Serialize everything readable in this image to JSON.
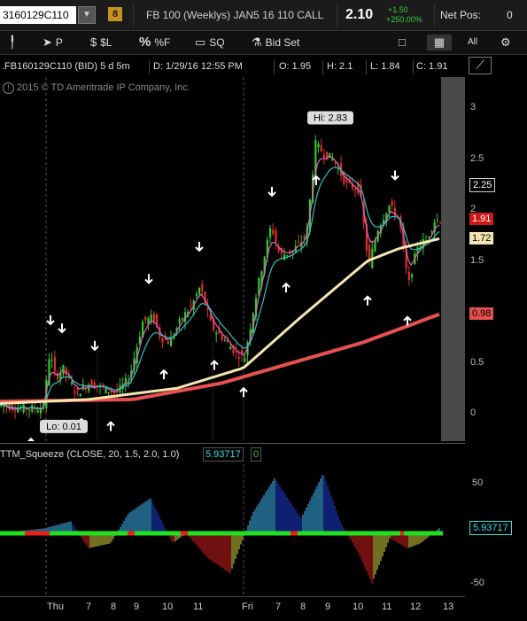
{
  "header": {
    "symbol": "3160129C110",
    "link_number": "8",
    "description": "FB 100 (Weeklys) JAN5 16 110 CALL",
    "last": "2.10",
    "change": "+1.50",
    "change_pct": "+250.00%",
    "net_pos_label": "Net Pos:",
    "net_pos_value": "0"
  },
  "toolbar": {
    "cursor_label": "P",
    "price_label": "$L",
    "percent_label": "%F",
    "sq_label": "SQ",
    "bidset_label": "Bid Set",
    "all_label": "All"
  },
  "chart_info": {
    "symbol": ".FB160129C110 (BID) 5 d 5m",
    "date": "D: 1/29/16 12:55 PM",
    "open": "O: 1.95",
    "high": "H: 2.1",
    "low": "L: 1.84",
    "close": "C: 1.91",
    "copyright": "2015 © TD Ameritrade IP Company, Inc.",
    "hi_label": "Hi: 2.83",
    "lo_label": "Lo: 0.01"
  },
  "price_axis": {
    "ticks": [
      "3",
      "2.5",
      "2",
      "1.5",
      "1",
      "0.5",
      "0"
    ],
    "tag_last": "2.25",
    "tag_close": "1.91",
    "tag_ma_fast": "1.72",
    "tag_ma_slow": "0.98"
  },
  "study": {
    "title": "TTM_Squeeze (CLOSE, 20, 1.5, 2.0, 1.0)",
    "value": "5.93717",
    "zero_value": "0",
    "ticks": [
      "50",
      "0",
      "-50"
    ],
    "tag_value": "5.93717"
  },
  "x_axis": {
    "labels": [
      "Thu",
      "7",
      "8",
      "9",
      "10",
      "11",
      "Fri",
      "7",
      "8",
      "9",
      "10",
      "11",
      "12",
      "13"
    ]
  },
  "colors": {
    "up_bar": "#2ecc2e",
    "down_bar": "#e0302a",
    "ma_fast": "#f5e6b0",
    "ma_slow": "#e85050",
    "ema_cyan": "#30c0c0",
    "ema_pink": "#e060c0",
    "squeeze_cyan": "#40c0ff",
    "squeeze_blue": "#2040e0",
    "squeeze_red": "#e02020",
    "squeeze_yellow": "#e0e040"
  },
  "chart_data": [
    {
      "type": "candlestick",
      "title": ".FB160129C110 (BID) 5 d 5m",
      "ylim": [
        -0.15,
        3.1
      ],
      "price_ticks": [
        0,
        0.5,
        1,
        1.5,
        2,
        2.5,
        3
      ],
      "close_path": [
        [
          0,
          0.08
        ],
        [
          28,
          0.05
        ],
        [
          48,
          0.06
        ],
        [
          55,
          0.6
        ],
        [
          62,
          0.35
        ],
        [
          70,
          0.45
        ],
        [
          85,
          0.2
        ],
        [
          100,
          0.3
        ],
        [
          115,
          0.25
        ],
        [
          130,
          0.2
        ],
        [
          145,
          0.35
        ],
        [
          160,
          0.9
        ],
        [
          172,
          0.95
        ],
        [
          180,
          0.75
        ],
        [
          190,
          0.7
        ],
        [
          205,
          0.95
        ],
        [
          215,
          1.05
        ],
        [
          225,
          1.25
        ],
        [
          238,
          0.85
        ],
        [
          250,
          0.75
        ],
        [
          265,
          0.6
        ],
        [
          275,
          0.55
        ],
        [
          290,
          1.25
        ],
        [
          305,
          1.85
        ],
        [
          315,
          1.55
        ],
        [
          330,
          1.6
        ],
        [
          345,
          1.75
        ],
        [
          355,
          2.65
        ],
        [
          365,
          2.55
        ],
        [
          375,
          2.5
        ],
        [
          390,
          2.25
        ],
        [
          405,
          2.2
        ],
        [
          415,
          1.45
        ],
        [
          425,
          1.8
        ],
        [
          438,
          2.05
        ],
        [
          450,
          1.9
        ],
        [
          460,
          1.25
        ],
        [
          470,
          1.65
        ],
        [
          480,
          1.7
        ],
        [
          490,
          1.9
        ],
        [
          497,
          1.91
        ]
      ],
      "ma_fast_path": [
        [
          0,
          0.1
        ],
        [
          100,
          0.14
        ],
        [
          200,
          0.25
        ],
        [
          275,
          0.45
        ],
        [
          340,
          0.95
        ],
        [
          415,
          1.5
        ],
        [
          450,
          1.62
        ],
        [
          497,
          1.72
        ]
      ],
      "ma_slow_path": [
        [
          0,
          0.12
        ],
        [
          150,
          0.14
        ],
        [
          250,
          0.3
        ],
        [
          330,
          0.5
        ],
        [
          410,
          0.7
        ],
        [
          460,
          0.86
        ],
        [
          497,
          0.98
        ]
      ],
      "high_marker": 2.83,
      "low_marker": 0.01,
      "last_tag": 2.25,
      "close_tag": 1.91,
      "ma_fast_tag": 1.72,
      "ma_slow_tag": 0.98
    },
    {
      "type": "bar",
      "title": "TTM_Squeeze (CLOSE, 20, 1.5, 2.0, 1.0)",
      "ylim": [
        -55,
        62
      ],
      "ticks": [
        50,
        0,
        -50
      ],
      "segments": [
        [
          0,
          0
        ],
        [
          50,
          5
        ],
        [
          80,
          12
        ],
        [
          100,
          -15
        ],
        [
          125,
          -10
        ],
        [
          145,
          20
        ],
        [
          170,
          35
        ],
        [
          195,
          -10
        ],
        [
          210,
          0
        ],
        [
          235,
          -25
        ],
        [
          260,
          -40
        ],
        [
          285,
          20
        ],
        [
          310,
          55
        ],
        [
          340,
          15
        ],
        [
          365,
          60
        ],
        [
          385,
          10
        ],
        [
          405,
          -20
        ],
        [
          420,
          -50
        ],
        [
          440,
          -5
        ],
        [
          460,
          -15
        ],
        [
          475,
          -10
        ],
        [
          497,
          5.93717
        ]
      ]
    }
  ]
}
